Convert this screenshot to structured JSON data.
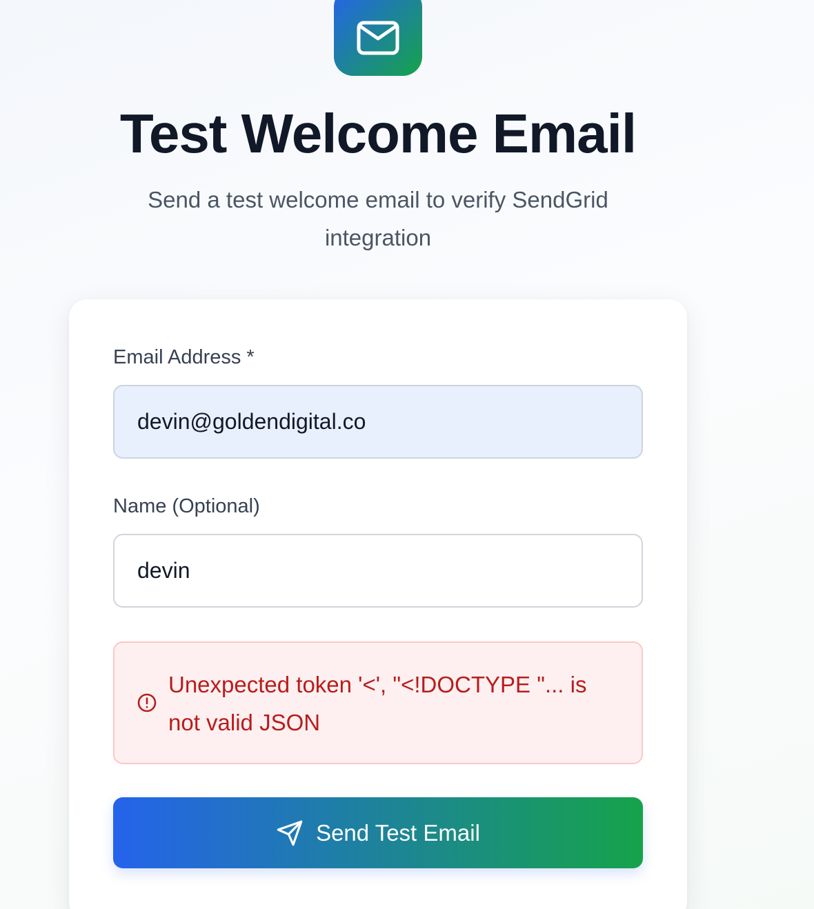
{
  "header": {
    "icon": "mail-icon",
    "title": "Test Welcome Email",
    "subtitle": "Send a test welcome email to verify SendGrid integration"
  },
  "form": {
    "email": {
      "label": "Email Address *",
      "value": "devin@goldendigital.co"
    },
    "name": {
      "label": "Name (Optional)",
      "value": "devin"
    },
    "error": {
      "icon": "alert-circle-icon",
      "message": "Unexpected token '<', \"<!DOCTYPE \"... is not valid JSON"
    },
    "submit": {
      "icon": "send-icon",
      "label": "Send Test Email"
    }
  },
  "colors": {
    "gradient_start": "#2563eb",
    "gradient_end": "#16a34a",
    "error_text": "#b91c1c",
    "error_background": "#fef0f0",
    "email_field_background": "#e8effd"
  }
}
